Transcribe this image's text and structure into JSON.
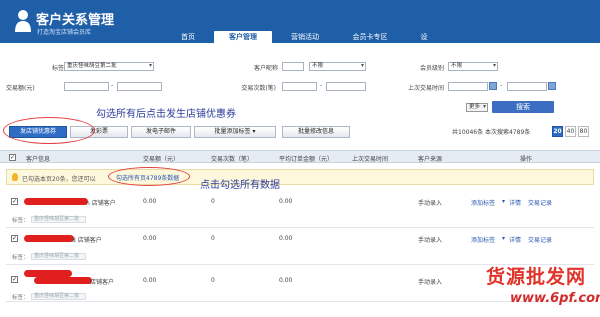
{
  "header": {
    "title": "客户关系管理",
    "subtitle": "打造淘宝店铺会员库",
    "nav": [
      "首页",
      "客户管理",
      "营销活动",
      "会员卡专区",
      "设"
    ],
    "active_nav": "客户管理"
  },
  "filters": {
    "tag_label": "标签",
    "tag_value": "重庆怪味胡豆第二批",
    "nickname_label": "客户昵称",
    "nickname_select": "不限",
    "level_label": "会员级别",
    "level_value": "不限",
    "amount_label": "交易额(元)",
    "count_label": "交易次数(笔)",
    "last_trade_label": "上次交易时间",
    "more_label": "更多",
    "search_button": "搜索"
  },
  "annotations": {
    "hint_top": "勾选所有后点击发生店铺优惠券",
    "hint_middle": "点击勾选所有数据"
  },
  "actions": {
    "send_coupon": "发店铺优惠券",
    "send_sms": "发彩票",
    "send_email": "发电子邮件",
    "batch_add_tag": "批量添加标签",
    "batch_edit": "批量修改信息"
  },
  "pagination": {
    "summary": "共10046条 本次搜索4789条",
    "sizes": [
      "20",
      "40",
      "80"
    ],
    "active_size": "20"
  },
  "table": {
    "headers": [
      "客户信息",
      "交易额（元）",
      "交易次数（笔）",
      "平均订单金额（元）",
      "上次交易时间",
      "客户来源",
      "操作"
    ],
    "notice": "已勾选本页20条，您还可以",
    "select_all_link": "勾选所有页4789条数据",
    "rows": [
      {
        "name_suffix": "n 店铺客户",
        "amount": "0.00",
        "count": "0",
        "avg": "0.00",
        "source": "手动录入",
        "tag_label": "标签：",
        "tag_value": "重庆怪味胡豆第二批",
        "checked": "✓"
      },
      {
        "name_suffix": "8 店铺客户",
        "amount": "0.00",
        "count": "0",
        "avg": "0.00",
        "source": "手动录入",
        "tag_label": "标签：",
        "tag_value": "重庆怪味胡豆第二批",
        "checked": "✓"
      },
      {
        "name_suffix": "店铺客户",
        "amount": "0.00",
        "count": "0",
        "avg": "0.00",
        "source": "手动录入",
        "tag_label": "标签：",
        "tag_value": "重庆怪味胡豆第二批",
        "checked": "✓"
      }
    ],
    "row_actions": {
      "add_tag": "添加标签",
      "detail": "详情",
      "history": "交易记录"
    }
  },
  "watermark": {
    "line1": "货源批发网",
    "line2": "www.6pf.com"
  },
  "colors": {
    "brand": "#1f5fa8",
    "accent": "#2f6cc4",
    "annotation": "#e34040"
  }
}
